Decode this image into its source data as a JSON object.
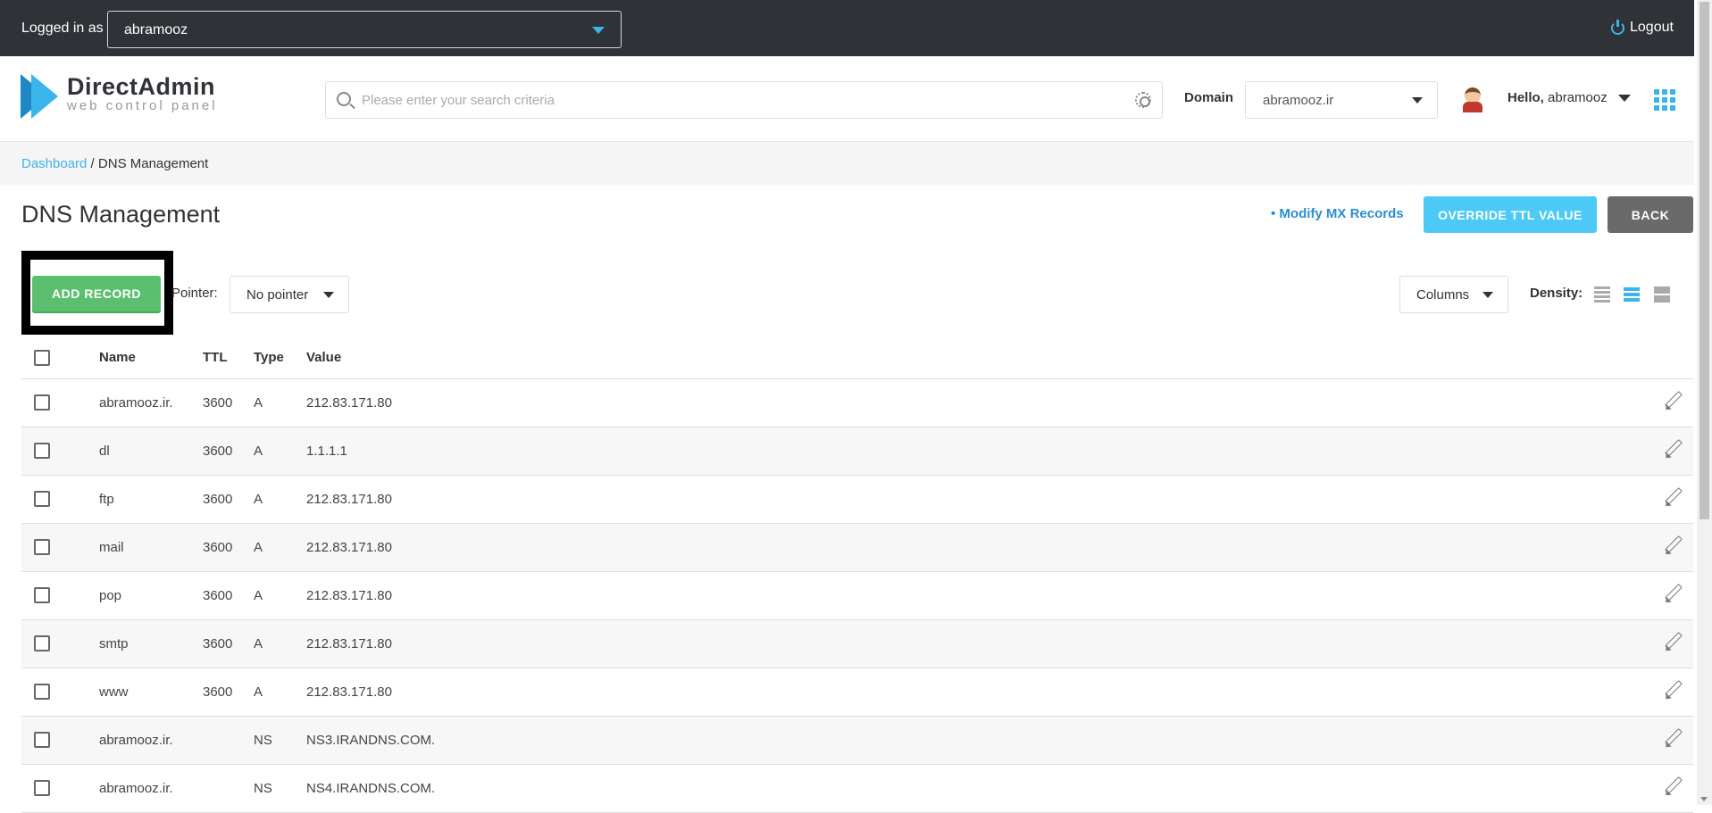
{
  "topbar": {
    "logged_in_label": "Logged in as",
    "user": "abramooz",
    "logout": "Logout"
  },
  "header": {
    "logo_title": "DirectAdmin",
    "logo_subtitle": "web control panel",
    "search_placeholder": "Please enter your search criteria",
    "domain_label": "Domain",
    "domain_value": "abramooz.ir",
    "hello_label": "Hello,",
    "hello_user": "abramooz"
  },
  "breadcrumb": {
    "home": "Dashboard",
    "separator": " / ",
    "current": "DNS Management"
  },
  "page": {
    "title": "DNS Management",
    "modify_mx": "• Modify MX Records",
    "override_ttl": "OVERRIDE TTL VALUE",
    "back": "BACK"
  },
  "toolbar": {
    "add_record": "ADD RECORD",
    "pointer_label": "Pointer:",
    "pointer_value": "No pointer",
    "columns": "Columns",
    "density_label": "Density:"
  },
  "table": {
    "headers": {
      "name": "Name",
      "ttl": "TTL",
      "type": "Type",
      "value": "Value"
    },
    "rows": [
      {
        "name": "abramooz.ir.",
        "ttl": "3600",
        "type": "A",
        "value": "212.83.171.80"
      },
      {
        "name": "dl",
        "ttl": "3600",
        "type": "A",
        "value": "1.1.1.1"
      },
      {
        "name": "ftp",
        "ttl": "3600",
        "type": "A",
        "value": "212.83.171.80"
      },
      {
        "name": "mail",
        "ttl": "3600",
        "type": "A",
        "value": "212.83.171.80"
      },
      {
        "name": "pop",
        "ttl": "3600",
        "type": "A",
        "value": "212.83.171.80"
      },
      {
        "name": "smtp",
        "ttl": "3600",
        "type": "A",
        "value": "212.83.171.80"
      },
      {
        "name": "www",
        "ttl": "3600",
        "type": "A",
        "value": "212.83.171.80"
      },
      {
        "name": "abramooz.ir.",
        "ttl": "",
        "type": "NS",
        "value": "NS3.IRANDNS.COM."
      },
      {
        "name": "abramooz.ir.",
        "ttl": "",
        "type": "NS",
        "value": "NS4.IRANDNS.COM."
      }
    ]
  },
  "icons": {
    "logout": "power-icon",
    "search": "search-icon",
    "settings": "gear-icon",
    "apps": "apps-grid-icon",
    "edit": "pencil-icon"
  },
  "colors": {
    "topbar_bg": "#2f3236",
    "accent": "#3bb5e9",
    "add_button": "#5cbf6f",
    "override_button": "#4dc9f6",
    "back_button": "#6a6a6a"
  }
}
